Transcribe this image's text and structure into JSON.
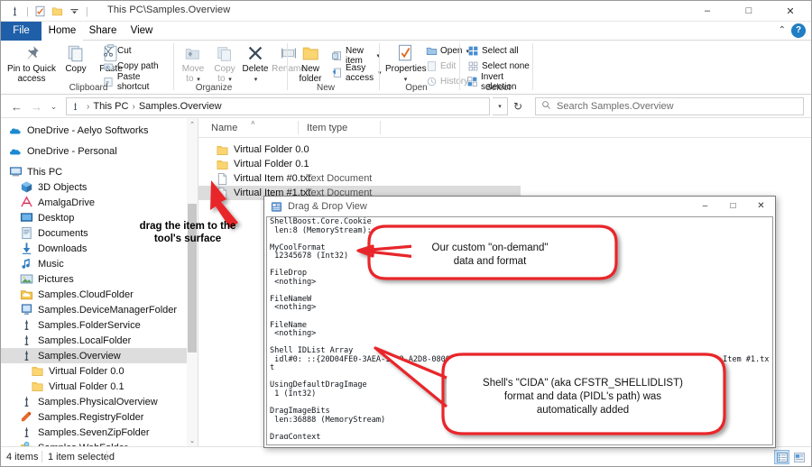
{
  "window": {
    "title": "This PC\\Samples.Overview",
    "minimize": "–",
    "maximize": "□",
    "close": "✕",
    "quick_access_icons": [
      "shellboost-icon",
      "properties-icon",
      "folder-icon",
      "customize-chevron"
    ]
  },
  "ribbon": {
    "tabs": [
      {
        "label": "File",
        "active": false,
        "file": true
      },
      {
        "label": "Home",
        "active": true
      },
      {
        "label": "Share",
        "active": false
      },
      {
        "label": "View",
        "active": false
      }
    ],
    "help_label": "?",
    "collapse_label": "⌃",
    "groups": [
      {
        "label": "Clipboard",
        "big": [
          {
            "label": "Pin to Quick\naccess",
            "icon": "pin-icon",
            "disabled": false
          },
          {
            "label": "Copy",
            "icon": "copy-icon",
            "disabled": false
          },
          {
            "label": "Paste",
            "icon": "paste-icon",
            "disabled": false
          }
        ],
        "small": [
          {
            "label": "Cut",
            "icon": "scissors-icon",
            "disabled": false
          },
          {
            "label": "Copy path",
            "icon": "copy-path-icon",
            "disabled": false
          },
          {
            "label": "Paste shortcut",
            "icon": "paste-shortcut-icon",
            "disabled": false
          }
        ]
      },
      {
        "label": "Organize",
        "big": [
          {
            "label": "Move\nto",
            "icon": "move-to-icon",
            "disabled": true,
            "caret": true
          },
          {
            "label": "Copy\nto",
            "icon": "copy-to-icon",
            "disabled": true,
            "caret": true
          },
          {
            "label": "Delete",
            "icon": "delete-icon",
            "disabled": false,
            "caret": true
          },
          {
            "label": "Rename",
            "icon": "rename-icon",
            "disabled": true
          }
        ],
        "small": []
      },
      {
        "label": "New",
        "big": [
          {
            "label": "New\nfolder",
            "icon": "new-folder-icon",
            "disabled": false
          }
        ],
        "small": [
          {
            "label": "New item",
            "icon": "new-item-icon",
            "disabled": false,
            "caret": true
          },
          {
            "label": "Easy access",
            "icon": "easy-access-icon",
            "disabled": false,
            "caret": true
          }
        ]
      },
      {
        "label": "Open",
        "big": [
          {
            "label": "Properties",
            "icon": "properties-icon",
            "disabled": false,
            "caret": true
          }
        ],
        "small": [
          {
            "label": "Open",
            "icon": "open-icon",
            "disabled": false,
            "caret": true
          },
          {
            "label": "Edit",
            "icon": "edit-icon",
            "disabled": true
          },
          {
            "label": "History",
            "icon": "history-icon",
            "disabled": true
          }
        ]
      },
      {
        "label": "Select",
        "big": [],
        "small": [
          {
            "label": "Select all",
            "icon": "select-all-icon",
            "disabled": false
          },
          {
            "label": "Select none",
            "icon": "select-none-icon",
            "disabled": false
          },
          {
            "label": "Invert selection",
            "icon": "invert-selection-icon",
            "disabled": false
          }
        ]
      }
    ]
  },
  "address": {
    "back": "←",
    "forward": "→",
    "recent": "⌄",
    "up": "↑",
    "crumb_icon": "shellboost-icon",
    "crumbs": [
      "This PC",
      "Samples.Overview"
    ],
    "separator": "›",
    "dropdown": "▾",
    "refresh": "↻",
    "search_icon": "search-icon",
    "search_placeholder": "Search Samples.Overview"
  },
  "nav_pane": {
    "scroll_up": "⌃",
    "scroll_down": "⌄",
    "items": [
      {
        "label": "OneDrive - Aelyo Softworks",
        "icon": "onedrive-icon",
        "indent": 0,
        "selected": false,
        "gap": true
      },
      {
        "label": "OneDrive - Personal",
        "icon": "onedrive-icon",
        "indent": 0,
        "selected": false,
        "gap": true
      },
      {
        "label": "This PC",
        "icon": "this-pc-icon",
        "indent": 0,
        "selected": false,
        "gap": true
      },
      {
        "label": "3D Objects",
        "icon": "3d-objects-icon",
        "indent": 1,
        "selected": false
      },
      {
        "label": "AmalgaDrive",
        "icon": "amalgadrive-icon",
        "indent": 1,
        "selected": false
      },
      {
        "label": "Desktop",
        "icon": "desktop-icon",
        "indent": 1,
        "selected": false
      },
      {
        "label": "Documents",
        "icon": "documents-icon",
        "indent": 1,
        "selected": false
      },
      {
        "label": "Downloads",
        "icon": "downloads-icon",
        "indent": 1,
        "selected": false
      },
      {
        "label": "Music",
        "icon": "music-icon",
        "indent": 1,
        "selected": false
      },
      {
        "label": "Pictures",
        "icon": "pictures-icon",
        "indent": 1,
        "selected": false
      },
      {
        "label": "Samples.CloudFolder",
        "icon": "cloud-folder-icon",
        "indent": 1,
        "selected": false
      },
      {
        "label": "Samples.DeviceManagerFolder",
        "icon": "device-manager-icon",
        "indent": 1,
        "selected": false
      },
      {
        "label": "Samples.FolderService",
        "icon": "shellboost-icon",
        "indent": 1,
        "selected": false
      },
      {
        "label": "Samples.LocalFolder",
        "icon": "shellboost-icon",
        "indent": 1,
        "selected": false
      },
      {
        "label": "Samples.Overview",
        "icon": "shellboost-icon",
        "indent": 1,
        "selected": true
      },
      {
        "label": "Virtual Folder 0.0",
        "icon": "folder-icon",
        "indent": 2,
        "selected": false
      },
      {
        "label": "Virtual Folder 0.1",
        "icon": "folder-icon",
        "indent": 2,
        "selected": false
      },
      {
        "label": "Samples.PhysicalOverview",
        "icon": "shellboost-icon",
        "indent": 1,
        "selected": false
      },
      {
        "label": "Samples.RegistryFolder",
        "icon": "registry-icon",
        "indent": 1,
        "selected": false
      },
      {
        "label": "Samples.SevenZipFolder",
        "icon": "shellboost-icon",
        "indent": 1,
        "selected": false
      },
      {
        "label": "Samples.WebFolder",
        "icon": "web-folder-icon",
        "indent": 1,
        "selected": false
      }
    ]
  },
  "file_list": {
    "columns": [
      {
        "label": "Name",
        "sorted": true,
        "sort_glyph": "˄"
      },
      {
        "label": "Item type",
        "sorted": false
      }
    ],
    "rows": [
      {
        "name": "Virtual Folder 0.0",
        "type": "",
        "icon": "folder-icon",
        "selected": false
      },
      {
        "name": "Virtual Folder 0.1",
        "type": "",
        "icon": "folder-icon",
        "selected": false
      },
      {
        "name": "Virtual Item #0.txt",
        "type": "Text Document",
        "icon": "text-file-icon",
        "selected": false
      },
      {
        "name": "Virtual Item #1.txt",
        "type": "Text Document",
        "icon": "text-file-icon",
        "selected": true
      }
    ]
  },
  "status_bar": {
    "items_count": "4 items",
    "selection": "1 item selected",
    "view_details_icon": "details-view-icon",
    "view_large_icon": "large-icons-view-icon"
  },
  "drag_drop_window": {
    "title": "Drag & Drop View",
    "icon": "shellboost-icon",
    "minimize": "–",
    "maximize": "□",
    "close": "✕",
    "content": "ShellBoost.Core.Cookie\n len:8 (MemoryStream): 281474976710663 0x0001000000000007\n\nMyCoolFormat\n 12345678 (Int32)\n\nFileDrop\n <nothing>\n\nFileNameW\n <nothing>\n\nFileName\n <nothing>\n\nShell IDList Array\n idl#0: ::{20D04FE0-3AEA-1069-A2D8-08002B30309D}\\::{70A2D52A-F623-97B9-CFAA-6E4561C686E2}\\Virtual Item #1.txt\n\nUsingDefaultDragImage\n 1 (Int32)\n\nDragImageBits\n len:36888 (MemoryStream)\n\nDragContext\n <nothing>\n\nDragSourceHelperFlags"
  },
  "annotations": {
    "drag_hint": "drag the item to the\ntool's surface",
    "callout1": "Our custom \"on-demand\"\ndata and format",
    "callout2": "Shell's \"CIDA\"  (aka CFSTR_SHELLIDLIST)\nformat and data (PIDL's path) was\nautomatically added",
    "accent_color": "#e8262b",
    "arrow_color": "#e8262b"
  }
}
